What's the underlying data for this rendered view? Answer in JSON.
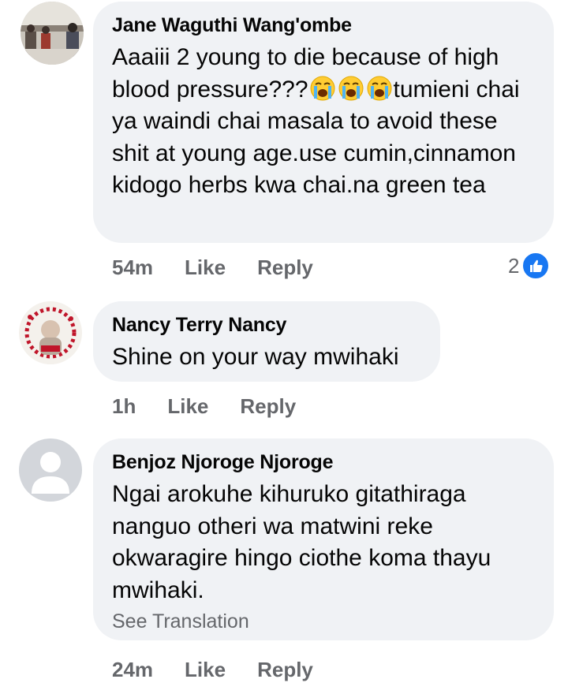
{
  "comments": [
    {
      "author": "Jane Waguthi Wang'ombe",
      "text_before": "Aaaiii 2 young to die because of high blood pressure???",
      "emoji_icon": "loudly-crying-face-icon",
      "text_after": "tumieni chai ya waindi chai masala to avoid these shit at young age.use cumin,cinnamon kidogo herbs kwa chai.na green tea",
      "time": "54m",
      "like_label": "Like",
      "reply_label": "Reply",
      "reaction_count": "2",
      "reaction_icon": "thumbs-up-icon"
    },
    {
      "author": "Nancy Terry Nancy",
      "text": "Shine on your way mwihaki",
      "time": "1h",
      "like_label": "Like",
      "reply_label": "Reply"
    },
    {
      "author": "Benjoz Njoroge Njoroge",
      "text": "Ngai arokuhe kihuruko gitathiraga nanguo otheri wa matwini reke okwaragire hingo ciothe koma thayu mwihaki.",
      "see_translation": "See Translation",
      "time": "24m",
      "like_label": "Like",
      "reply_label": "Reply"
    }
  ],
  "colors": {
    "bubble": "#f0f2f5",
    "meta": "#65676b",
    "like_blue": "#1877f2"
  }
}
